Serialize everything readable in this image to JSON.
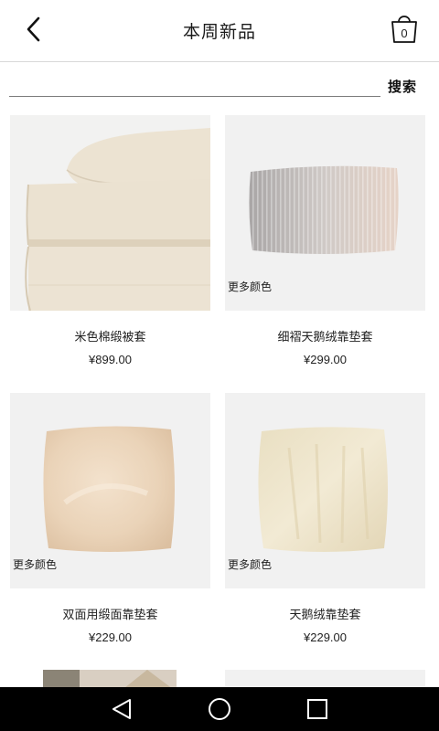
{
  "header": {
    "title": "本周新品",
    "cart_count": "0"
  },
  "search": {
    "value": "",
    "button_label": "搜索"
  },
  "products": [
    {
      "name": "米色棉缎被套",
      "price": "¥899.00",
      "more_colors": ""
    },
    {
      "name": "细褶天鹅绒靠垫套",
      "price": "¥299.00",
      "more_colors": "更多颜色"
    },
    {
      "name": "双面用缎面靠垫套",
      "price": "¥229.00",
      "more_colors": "更多颜色"
    },
    {
      "name": "天鹅绒靠垫套",
      "price": "¥229.00",
      "more_colors": "更多颜色"
    }
  ],
  "icons": {
    "back": "chevron-left-icon",
    "cart": "shopping-bag-icon",
    "nav_back": "triangle-back-icon",
    "nav_home": "circle-home-icon",
    "nav_recents": "square-recents-icon"
  },
  "colors": {
    "nav_bar": "#000000",
    "thumb_bg": "#f1f1f1",
    "divider": "#d9d9d9"
  }
}
